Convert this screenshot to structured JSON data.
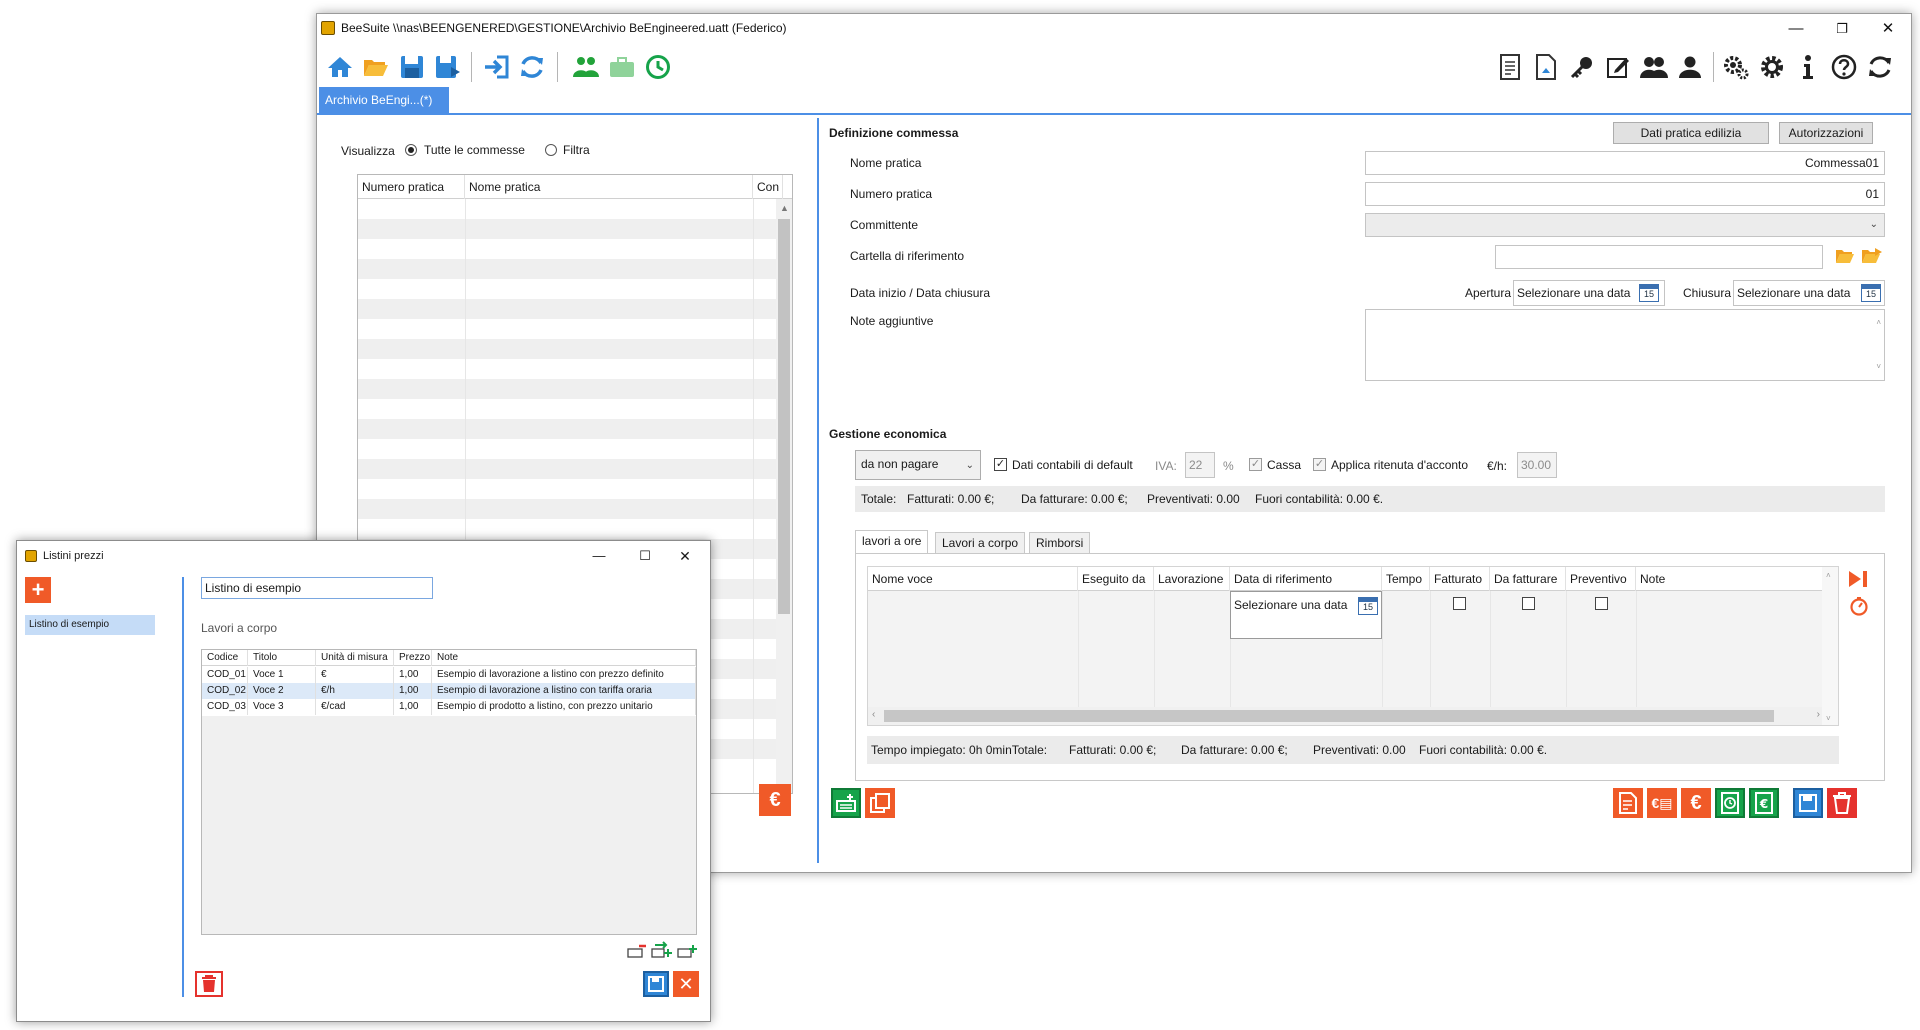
{
  "main_window": {
    "title": "BeeSuite \\\\nas\\BEENGENERED\\GESTIONE\\Archivio BeEngineered.uatt (Federico)",
    "doc_tab": "Archivio BeEngi...(*)",
    "toolbar_icons": [
      "home-icon",
      "folder-open-icon",
      "save-icon",
      "save-as-icon",
      "import-icon",
      "refresh-icon",
      "users-icon",
      "briefcase-icon",
      "clock-icon",
      "document-icon",
      "page-icon",
      "key-icon",
      "edit-icon",
      "group-icon",
      "user-icon",
      "gears-icon",
      "gear-icon",
      "info-icon",
      "help-icon",
      "sync-icon"
    ]
  },
  "left_panel": {
    "visualizza_label": "Visualizza",
    "radio_all": "Tutte le commesse",
    "radio_filter": "Filtra",
    "columns": [
      "Numero pratica",
      "Nome pratica",
      "Con"
    ]
  },
  "definizione": {
    "title": "Definizione commessa",
    "btn_dati_pratica": "Dati pratica edilizia",
    "btn_autorizzazioni": "Autorizzazioni",
    "nome_pratica_label": "Nome pratica",
    "nome_pratica_value": "Commessa01",
    "numero_pratica_label": "Numero pratica",
    "numero_pratica_value": "01",
    "committente_label": "Committente",
    "cartella_label": "Cartella di riferimento",
    "date_label": "Data inizio / Data chiusura",
    "apertura_label": "Apertura",
    "apertura_value": "Selezionare una data",
    "chiusura_label": "Chiusura",
    "chiusura_value": "Selezionare una data",
    "note_label": "Note aggiuntive",
    "calendar_day": "15"
  },
  "gestione": {
    "title": "Gestione economica",
    "payment_status": "da non pagare",
    "dati_contabili": "Dati contabili di default",
    "iva_label": "IVA:",
    "iva_value": "22",
    "percent": "%",
    "cassa": "Cassa",
    "ritenuta": "Applica ritenuta d'acconto",
    "rate_label": "€/h:",
    "rate_value": "30.00",
    "totals": {
      "totale": "Totale:",
      "fatturati": "Fatturati: 0.00 €;",
      "da_fatturare": "Da fatturare: 0.00 €;",
      "preventivati": "Preventivati: 0.00",
      "fuori": "Fuori contabilità: 0.00 €."
    },
    "tabs": [
      "lavori a ore",
      "Lavori a corpo",
      "Rimborsi"
    ],
    "columns": [
      "Nome voce",
      "Eseguito da",
      "Lavorazione",
      "Data di riferimento",
      "Tempo",
      "Fatturato",
      "Da fatturare",
      "Preventivo",
      "Note"
    ],
    "row_date": "Selezionare una data",
    "footer": {
      "tempo": "Tempo impiegato: 0h 0minTotale:",
      "fatturati": "Fatturati: 0.00 €;",
      "da_fatturare": "Da fatturare: 0.00 €;",
      "preventivati": "Preventivati: 0.00",
      "fuori": "Fuori contabilità: 0.00 €."
    }
  },
  "listini": {
    "title": "Listini prezzi",
    "sidebar_item": "Listino di esempio",
    "name_value": "Listino di esempio",
    "section": "Lavori a corpo",
    "columns": [
      "Codice",
      "Titolo",
      "Unità di misura",
      "Prezzo",
      "Note"
    ],
    "rows": [
      {
        "codice": "COD_01",
        "titolo": "Voce 1",
        "unita": "€",
        "prezzo": "1,00",
        "note": "Esempio di lavorazione a listino con prezzo definito"
      },
      {
        "codice": "COD_02",
        "titolo": "Voce 2",
        "unita": "€/h",
        "prezzo": "1,00",
        "note": "Esempio di lavorazione a listino con tariffa oraria"
      },
      {
        "codice": "COD_03",
        "titolo": "Voce 3",
        "unita": "€/cad",
        "prezzo": "1,00",
        "note": "Esempio di prodotto a listino, con prezzo unitario"
      }
    ]
  },
  "colors": {
    "accent_blue": "#4c8fe6",
    "orange": "#f05a28",
    "green": "#16a34a",
    "red": "#e5322d"
  }
}
